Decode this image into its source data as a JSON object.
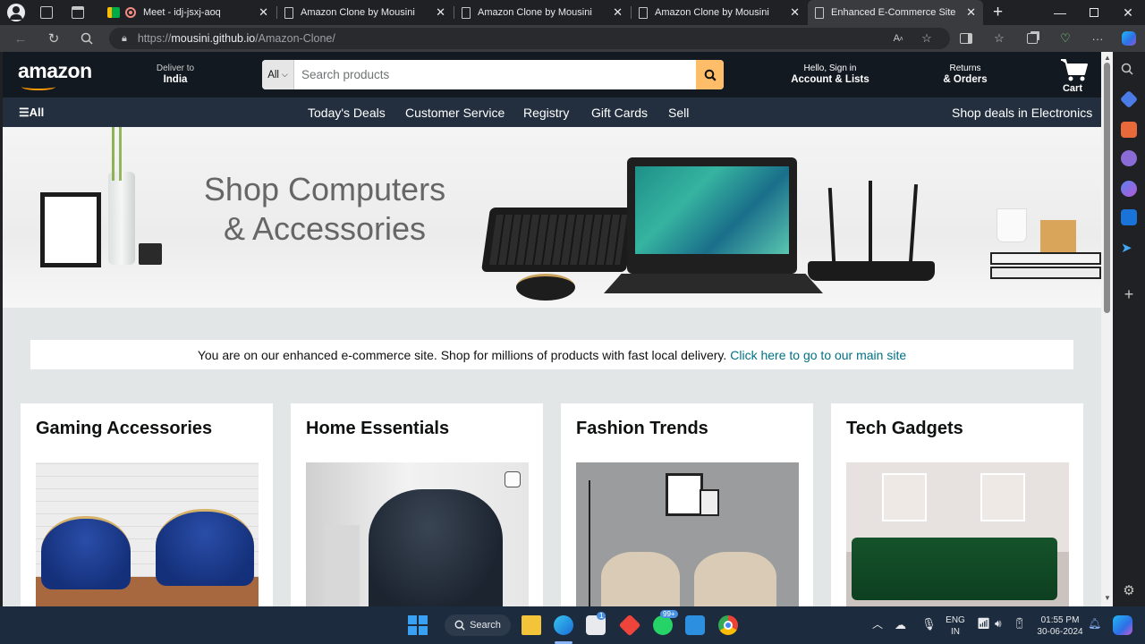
{
  "browser": {
    "tabs": [
      {
        "title": "Meet - idj-jsxj-aoq"
      },
      {
        "title": "Amazon Clone by Mousini"
      },
      {
        "title": "Amazon Clone by Mousini"
      },
      {
        "title": "Amazon Clone by Mousini"
      },
      {
        "title": "Enhanced E-Commerce Site"
      }
    ],
    "url_prefix": "https://",
    "url_host": "mousini.github.io",
    "url_path": "/Amazon-Clone/"
  },
  "header": {
    "logo": "amazon",
    "deliver_small": "Deliver to",
    "deliver_big": "India",
    "search_category": "All",
    "search_placeholder": "Search products",
    "account_small": "Hello, Sign in",
    "account_big": "Account & Lists",
    "returns_small": "Returns",
    "returns_big": "& Orders",
    "cart_label": "Cart"
  },
  "nav": {
    "all": "All",
    "items": [
      "Today's Deals",
      "Customer Service",
      "Registry",
      "Gift Cards",
      "Sell"
    ],
    "promo": "Shop deals in Electronics"
  },
  "hero": {
    "line1": "Shop Computers",
    "line2": "& Accessories"
  },
  "notice": {
    "text": "You are on our enhanced e-commerce site. Shop for millions of products with fast local delivery.",
    "link": "Click here to go to our main site"
  },
  "cards": [
    {
      "title": "Gaming Accessories"
    },
    {
      "title": "Home Essentials"
    },
    {
      "title": "Fashion Trends"
    },
    {
      "title": "Tech Gadgets"
    }
  ],
  "taskbar": {
    "search_label": "Search",
    "store_badge": "1",
    "whatsapp_badge": "99+",
    "lang_line1": "ENG",
    "lang_line2": "IN",
    "time": "01:55 PM",
    "date": "30-06-2024"
  },
  "colors": {
    "amazon_dark": "#131921",
    "amazon_nav": "#232f3e",
    "amazon_orange": "#ff9900",
    "search_button": "#febd69",
    "link_teal": "#007185"
  }
}
